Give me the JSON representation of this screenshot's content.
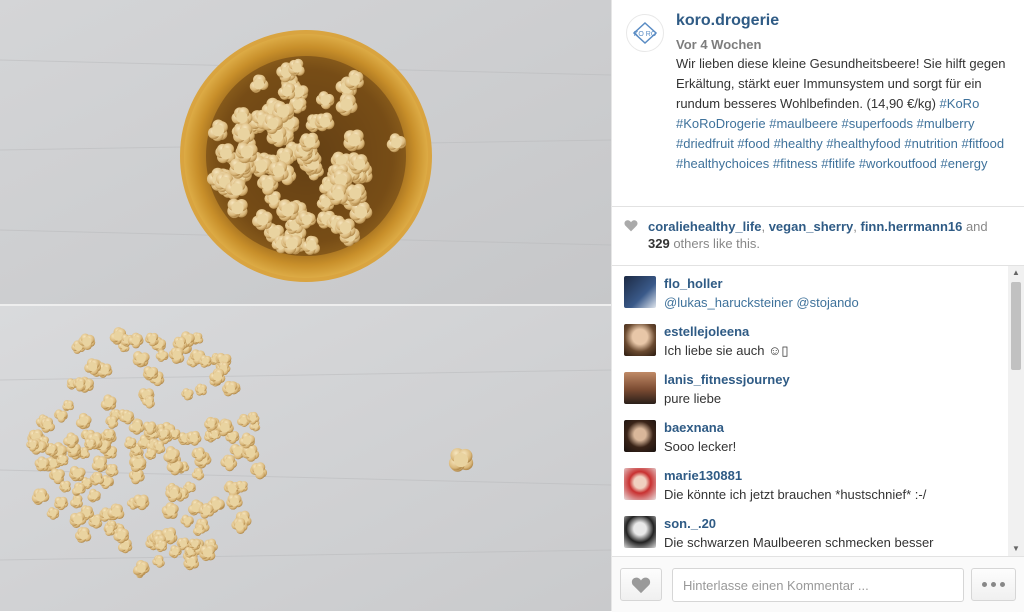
{
  "post": {
    "username": "koro.drogerie",
    "time_ago": "Vor 4 Wochen",
    "caption": "Wir lieben diese kleine Gesundheitsbeere! Sie hilft gegen Erkältung, stärkt euer Immunsystem und sorgt für ein rundum besseres Wohlbefinden. (14,90 €/kg)",
    "hashtags": "#KoRo #KoRoDrogerie #maulbeere #superfoods #mulberry #driedfruit #food #healthy #healthyfood #nutrition #fitfood #healthychoices #fitness #fitlife #workoutfood #energy",
    "logo_text": "KO RO"
  },
  "likes": {
    "user1": "coraliehealthy_life",
    "sep1": ", ",
    "user2": "vegan_sherry",
    "sep2": ", ",
    "user3": "finn.herrmann16",
    "and_text": " and",
    "count": "329",
    "others_text": " others like this."
  },
  "comments": [
    {
      "user": "flo_holler",
      "text": "@lukas_harucksteiner @stojando"
    },
    {
      "user": "estellejoleena",
      "text": "Ich liebe sie auch ☺▯"
    },
    {
      "user": "lanis_fitnessjourney",
      "text": "pure liebe"
    },
    {
      "user": "baexnana",
      "text": "Sooo lecker!"
    },
    {
      "user": "marie130881",
      "text": "Die könnte ich jetzt brauchen *hustschnief* :-/"
    },
    {
      "user": "son._.20",
      "text": "Die schwarzen Maulbeeren schmecken besser"
    }
  ],
  "footer": {
    "comment_placeholder": "Hinterlasse einen Kommentar ..."
  },
  "colors": {
    "link": "#2f5b85",
    "hashtag": "#3f729b"
  },
  "icons": {
    "like": "heart-icon",
    "more": "more-options-icon",
    "scroll_up": "scroll-up-icon",
    "scroll_down": "scroll-down-icon"
  }
}
